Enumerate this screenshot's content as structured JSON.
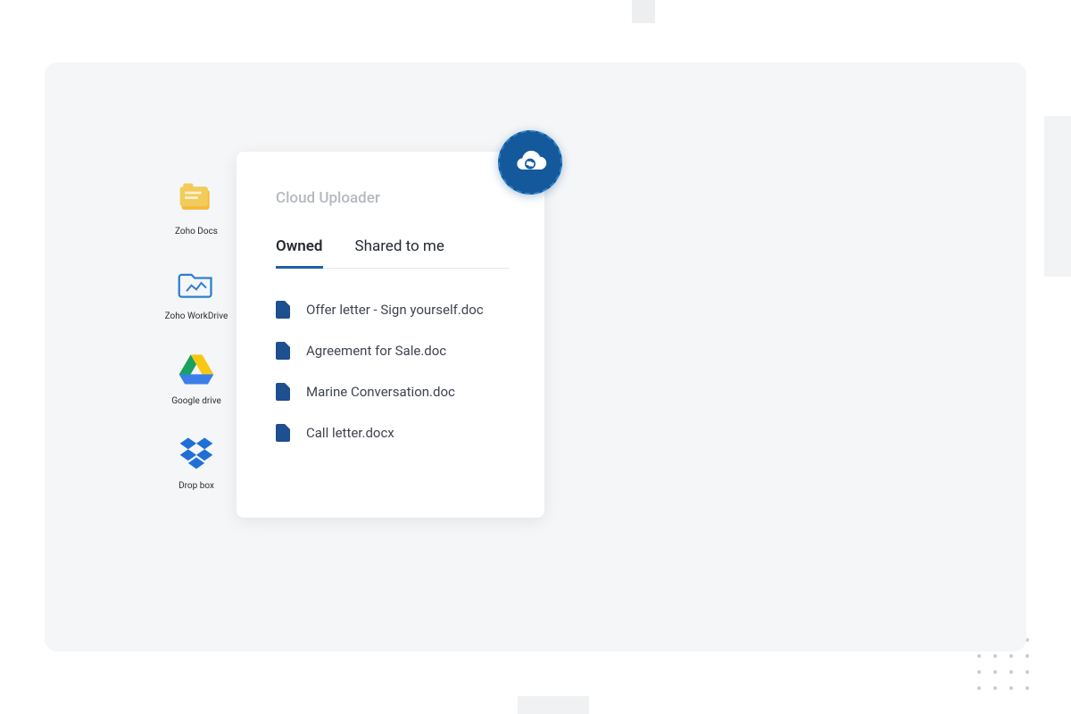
{
  "sources": [
    {
      "id": "zoho-docs",
      "label": "Zoho Docs"
    },
    {
      "id": "zoho-workdrive",
      "label": "Zoho WorkDrive"
    },
    {
      "id": "google-drive",
      "label": "Google drive"
    },
    {
      "id": "dropbox",
      "label": "Drop box"
    }
  ],
  "panel": {
    "title": "Cloud Uploader",
    "tabs": {
      "owned": "Owned",
      "shared": "Shared to me",
      "active": "owned"
    },
    "files": [
      {
        "name": "Offer letter - Sign yourself.doc"
      },
      {
        "name": "Agreement for Sale.doc"
      },
      {
        "name": "Marine Conversation.doc"
      },
      {
        "name": "Call letter.docx"
      }
    ]
  }
}
